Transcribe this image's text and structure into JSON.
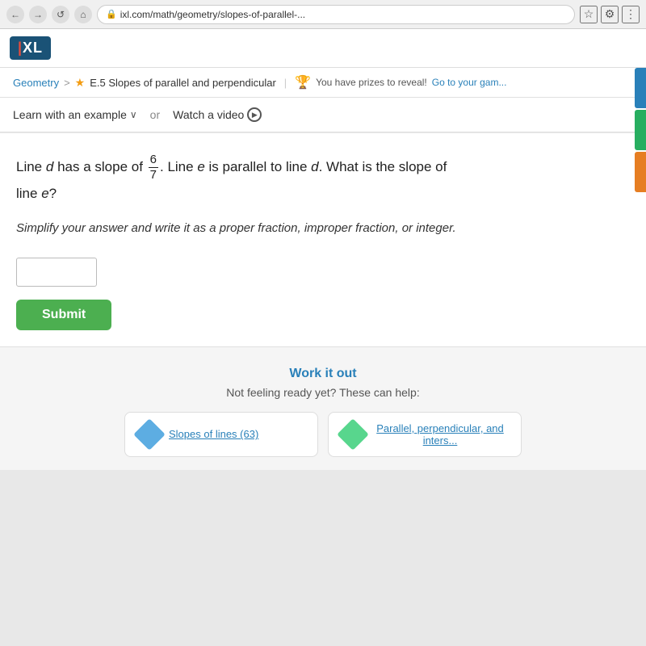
{
  "browser": {
    "url": "ixl.com/math/geometry/slopes-of-parallel-...",
    "back_label": "←",
    "forward_label": "→",
    "refresh_label": "↺",
    "home_label": "⌂"
  },
  "header": {
    "logo_i": "I",
    "logo_xl": "XL"
  },
  "breadcrumb": {
    "geometry_label": "Geometry",
    "separator": ">",
    "lesson_title": "E.5 Slopes of parallel and perpendicular",
    "prizes_text": "You have prizes to reveal!",
    "prizes_link": "Go to your gam..."
  },
  "learn_bar": {
    "learn_label": "Learn with an example",
    "dropdown_arrow": "∨",
    "or_label": "or",
    "video_label": "Watch a video"
  },
  "question": {
    "line_d_prefix": "Line ",
    "line_d_var": "d",
    "slope_prefix": " has a slope of ",
    "fraction_num": "6",
    "fraction_den": "7",
    "slope_suffix": ". Line e is parallel to line ",
    "line_d_var2": "d",
    "slope_question": ". What is the slope of",
    "line_e": "line e?"
  },
  "instruction": {
    "text": "Simplify your answer and write it as a proper fraction, improper fraction, or integer."
  },
  "answer_input": {
    "placeholder": ""
  },
  "submit_button": {
    "label": "Submit"
  },
  "bottom": {
    "work_it_out_title": "Work it out",
    "not_ready_text": "Not feeling ready yet? These can help:",
    "help_card_1": "Slopes of lines (63)",
    "help_card_2": "Parallel, perpendicular, and inters..."
  }
}
